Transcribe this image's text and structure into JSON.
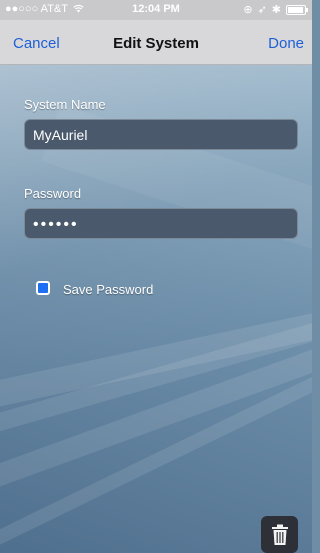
{
  "status_bar": {
    "carrier": "●●○○○ AT&T",
    "time": "12:04 PM"
  },
  "nav": {
    "cancel_label": "Cancel",
    "title": "Edit System",
    "done_label": "Done"
  },
  "form": {
    "system_name_label": "System Name",
    "system_name_value": "MyAuriel",
    "password_label": "Password",
    "password_value": "••••••",
    "save_password_label": "Save Password",
    "save_password_checked": true
  },
  "icons": {
    "wifi": "wifi-icon",
    "battery": "battery-icon",
    "trash": "trash-icon",
    "location": "location-icon",
    "bluetooth": "bluetooth-icon"
  },
  "colors": {
    "accent": "#1e5fd6",
    "checkbox": "#1f6ff2"
  }
}
